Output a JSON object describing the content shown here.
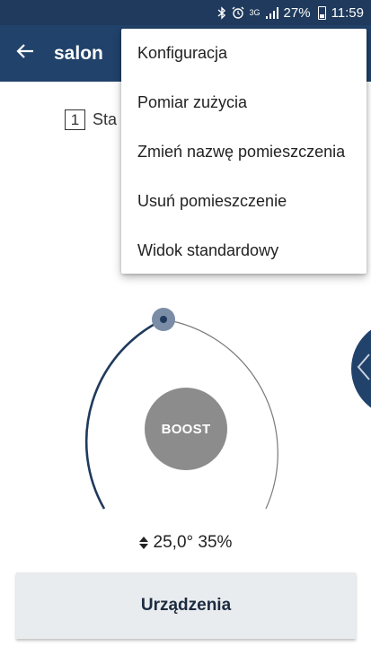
{
  "status_bar": {
    "bluetooth_icon": "bluetooth-icon",
    "alarm_icon": "alarm-icon",
    "network_label": "3G",
    "signal_icon": "signal-icon",
    "battery_percent": "27%",
    "battery_icon": "battery-icon",
    "time": "11:59"
  },
  "app_bar": {
    "back_icon": "arrow-left-icon",
    "title": "salon"
  },
  "step": {
    "number": "1",
    "label_fragment": "Sta"
  },
  "dial": {
    "boost_label": "BOOST",
    "level": 0.36
  },
  "reading": {
    "icon": "up-down-arrows-icon",
    "text": "25,0° 35%"
  },
  "devices_button": {
    "label": "Urządzenia"
  },
  "side_tab": {
    "icon": "chevron-left-icon"
  },
  "menu": {
    "items": [
      {
        "label": "Konfiguracja"
      },
      {
        "label": "Pomiar zużycia"
      },
      {
        "label": "Zmień nazwę pomieszczenia"
      },
      {
        "label": "Usuń pomieszczenie"
      },
      {
        "label": "Widok standardowy"
      }
    ]
  },
  "colors": {
    "primary": "#21426a",
    "status_bar": "#1f3a5c",
    "boost": "#8c8c8c",
    "button_bg": "#e9ecee"
  }
}
